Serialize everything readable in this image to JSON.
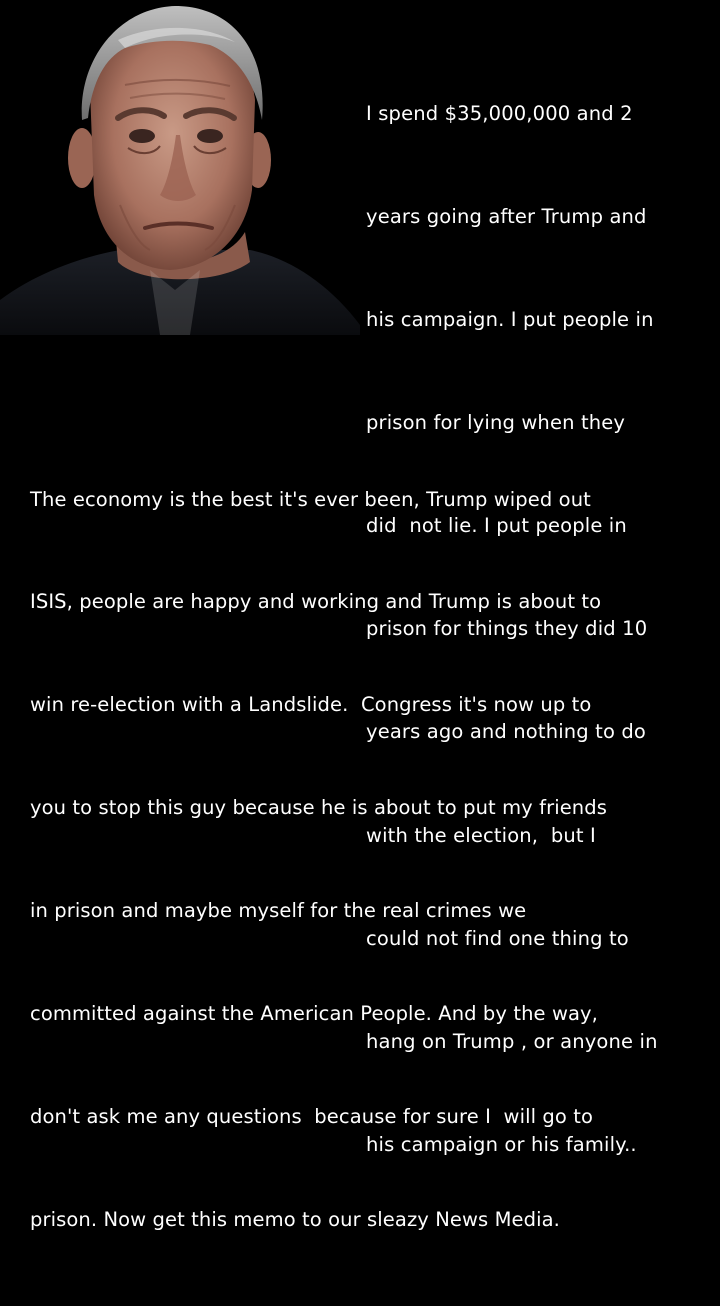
{
  "quote": {
    "top_lines": [
      "I spend $35,000,000 and 2",
      "years going after Trump and",
      "his campaign. I put people in",
      "prison for lying when they",
      "did  not lie. I put people in",
      "prison for things they did 10",
      "years ago and nothing to do",
      "with the election,  but I",
      "could not find one thing to",
      "hang on Trump , or anyone in",
      "his campaign or his family.."
    ],
    "bottom_lines": [
      "The economy is the best it's ever been, Trump wiped out",
      "ISIS, people are happy and working and Trump is about to",
      "win re-election with a Landslide.  Congress it's now up to",
      "you to stop this guy because he is about to put my friends",
      "in prison and maybe myself for the real crimes we",
      "committed against the American People. And by the way,",
      "don't ask me any questions  because for sure I  will go to",
      "prison. Now get this memo to our sleazy News Media."
    ]
  },
  "colors": {
    "background": "#000000",
    "text": "#ffffff"
  },
  "portrait": {
    "icon": "person-portrait-photo"
  }
}
